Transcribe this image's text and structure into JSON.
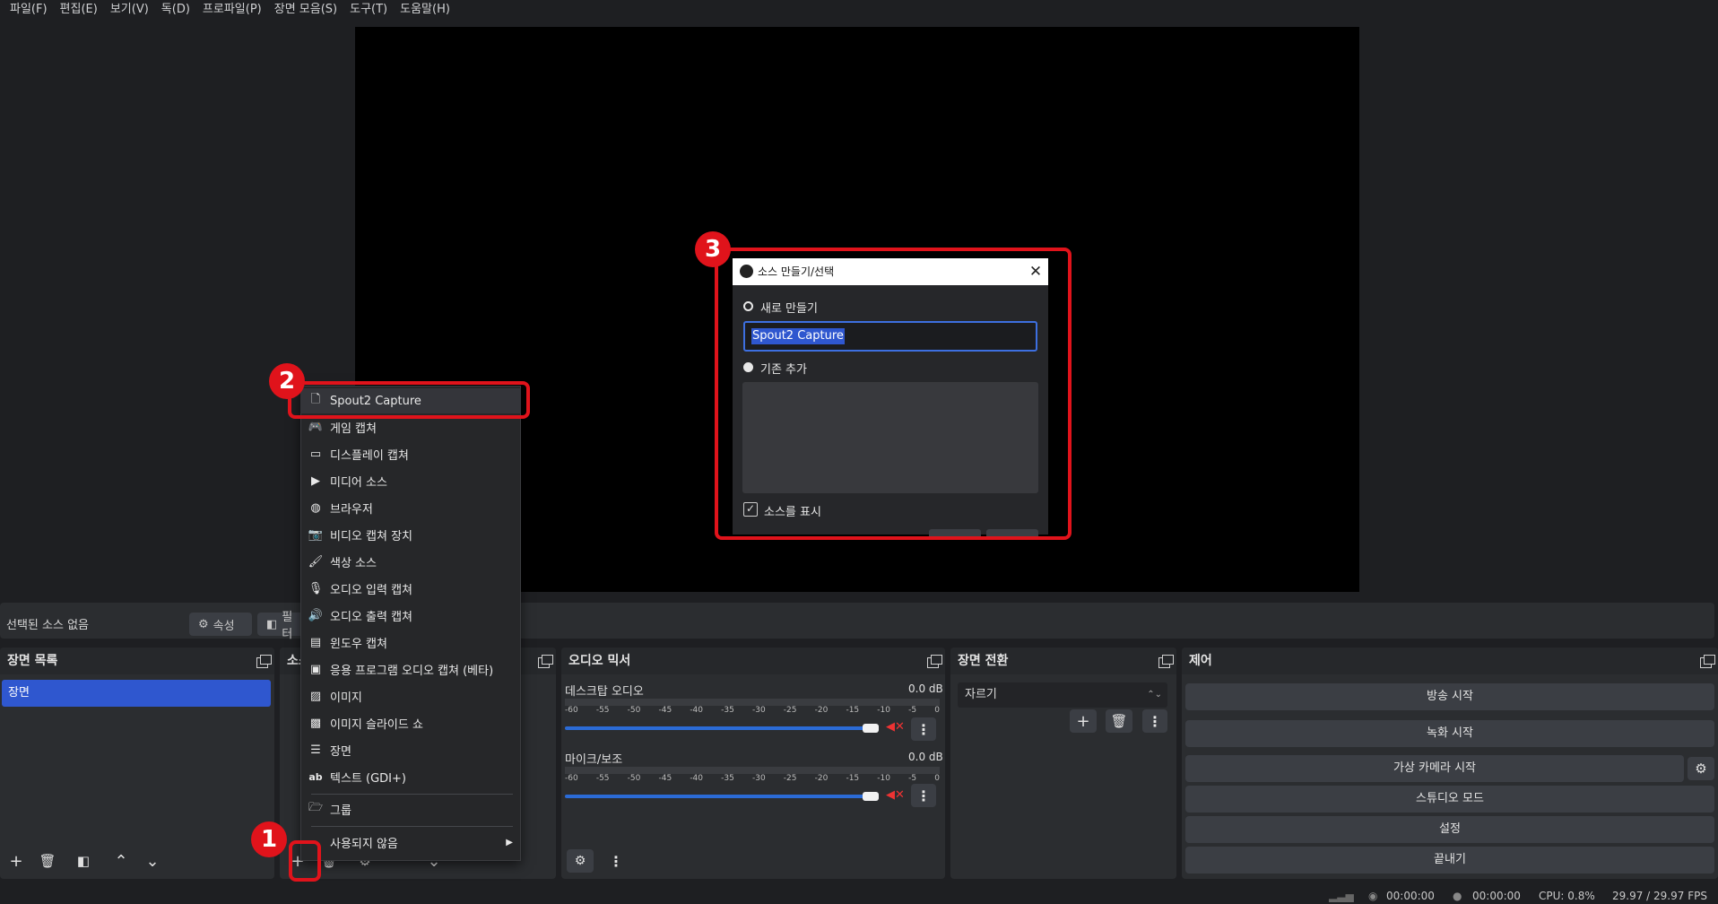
{
  "menu": [
    "파일(F)",
    "편집(E)",
    "보기(V)",
    "독(D)",
    "프로파일(P)",
    "장면 모음(S)",
    "도구(T)",
    "도움말(H)"
  ],
  "context_bar": {
    "no_source": "선택된 소스 없음",
    "properties": "속성",
    "filters": "필터"
  },
  "scenes": {
    "title": "장면 목록",
    "items": [
      "장면"
    ]
  },
  "sources": {
    "title": "소스"
  },
  "mixer": {
    "title": "오디오 믹서",
    "scale": [
      "-60",
      "-55",
      "-50",
      "-45",
      "-40",
      "-35",
      "-30",
      "-25",
      "-20",
      "-15",
      "-10",
      "-5",
      "0"
    ],
    "channels": [
      {
        "name": "데스크탑 오디오",
        "db": "0.0 dB",
        "volume": 1.0
      },
      {
        "name": "마이크/보조",
        "db": "0.0 dB",
        "volume": 1.0
      }
    ]
  },
  "transitions": {
    "title": "장면 전환",
    "selected": "자르기"
  },
  "controls": {
    "title": "제어",
    "buttons": [
      "방송 시작",
      "녹화 시작",
      "가상 카메라 시작",
      "스튜디오 모드",
      "설정",
      "끝내기"
    ]
  },
  "status": {
    "stream_time": "00:00:00",
    "rec_time": "00:00:00",
    "cpu": "CPU: 0.8%",
    "fps": "29.97 / 29.97 FPS"
  },
  "add_menu": {
    "items": [
      {
        "label": "Spout2 Capture",
        "icon": "file-icon"
      },
      {
        "label": "게임 캡쳐",
        "icon": "gamepad-icon"
      },
      {
        "label": "디스플레이 캡쳐",
        "icon": "monitor-icon"
      },
      {
        "label": "미디어 소스",
        "icon": "play-icon"
      },
      {
        "label": "브라우저",
        "icon": "globe-icon"
      },
      {
        "label": "비디오 캡쳐 장치",
        "icon": "camera-icon"
      },
      {
        "label": "색상 소스",
        "icon": "brush-icon"
      },
      {
        "label": "오디오 입력 캡쳐",
        "icon": "mic-icon"
      },
      {
        "label": "오디오 출력 캡쳐",
        "icon": "speaker-icon"
      },
      {
        "label": "윈도우 캡쳐",
        "icon": "window-icon"
      },
      {
        "label": "응용 프로그램 오디오 캡쳐 (베타)",
        "icon": "app-audio-icon"
      },
      {
        "label": "이미지",
        "icon": "image-icon"
      },
      {
        "label": "이미지 슬라이드 쇼",
        "icon": "slideshow-icon"
      },
      {
        "label": "장면",
        "icon": "list-icon"
      },
      {
        "label": "텍스트 (GDI+)",
        "icon": "text-icon"
      },
      {
        "label": "그룹",
        "icon": "folder-icon"
      },
      {
        "label": "사용되지 않음",
        "icon": ""
      }
    ]
  },
  "dialog": {
    "title": "소스 만들기/선택",
    "new_label": "새로 만들기",
    "name_value": "Spout2 Capture",
    "existing_label": "기존 추가",
    "show_source": "소스를 표시",
    "show_source_checked": true
  },
  "badges": [
    "1",
    "2",
    "3"
  ],
  "colors": {
    "highlight": "#e0131b",
    "accent": "#2f57cf"
  }
}
